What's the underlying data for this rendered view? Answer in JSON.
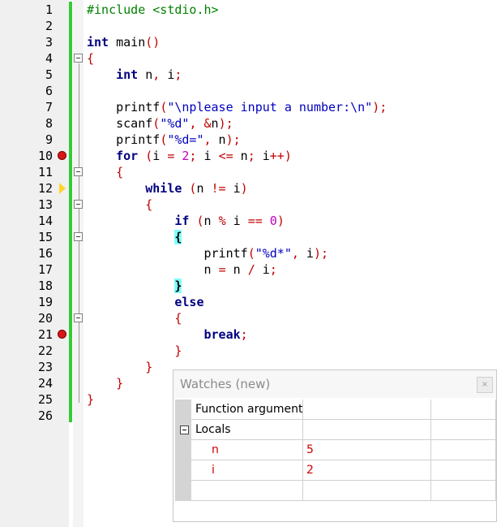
{
  "editor": {
    "line_numbers": [
      "1",
      "2",
      "3",
      "4",
      "5",
      "6",
      "7",
      "8",
      "9",
      "10",
      "11",
      "12",
      "13",
      "14",
      "15",
      "16",
      "17",
      "18",
      "19",
      "20",
      "21",
      "22",
      "23",
      "24",
      "25",
      "26"
    ],
    "lines": [
      [
        {
          "t": "#include <stdio.h>",
          "c": "pp"
        }
      ],
      [],
      [
        {
          "t": "int",
          "c": "kw"
        },
        {
          "t": " main"
        },
        {
          "t": "()",
          "c": "op"
        }
      ],
      [
        {
          "t": "{",
          "c": "op"
        }
      ],
      [
        {
          "t": "    "
        },
        {
          "t": "int",
          "c": "kw"
        },
        {
          "t": " n"
        },
        {
          "t": ",",
          "c": "op"
        },
        {
          "t": " i"
        },
        {
          "t": ";",
          "c": "op"
        }
      ],
      [],
      [
        {
          "t": "    printf"
        },
        {
          "t": "(",
          "c": "op"
        },
        {
          "t": "\"\\nplease input a number:\\n\"",
          "c": "str"
        },
        {
          "t": ");",
          "c": "op"
        }
      ],
      [
        {
          "t": "    scanf"
        },
        {
          "t": "(",
          "c": "op"
        },
        {
          "t": "\"%d\"",
          "c": "str"
        },
        {
          "t": ", &",
          "c": "op"
        },
        {
          "t": "n"
        },
        {
          "t": ");",
          "c": "op"
        }
      ],
      [
        {
          "t": "    printf"
        },
        {
          "t": "(",
          "c": "op"
        },
        {
          "t": "\"%d=\"",
          "c": "str"
        },
        {
          "t": ",",
          "c": "op"
        },
        {
          "t": " n"
        },
        {
          "t": ");",
          "c": "op"
        }
      ],
      [
        {
          "t": "    "
        },
        {
          "t": "for",
          "c": "kw"
        },
        {
          "t": " (",
          "c": "op"
        },
        {
          "t": "i "
        },
        {
          "t": "=",
          "c": "op"
        },
        {
          "t": " "
        },
        {
          "t": "2",
          "c": "num"
        },
        {
          "t": ";",
          "c": "op"
        },
        {
          "t": " i "
        },
        {
          "t": "<=",
          "c": "op"
        },
        {
          "t": " n"
        },
        {
          "t": ";",
          "c": "op"
        },
        {
          "t": " i"
        },
        {
          "t": "++)",
          "c": "op"
        }
      ],
      [
        {
          "t": "    "
        },
        {
          "t": "{",
          "c": "op"
        }
      ],
      [
        {
          "t": "        "
        },
        {
          "t": "while",
          "c": "kw"
        },
        {
          "t": " (",
          "c": "op"
        },
        {
          "t": "n "
        },
        {
          "t": "!=",
          "c": "op"
        },
        {
          "t": " i"
        },
        {
          "t": ")",
          "c": "op"
        }
      ],
      [
        {
          "t": "        "
        },
        {
          "t": "{",
          "c": "op"
        }
      ],
      [
        {
          "t": "            "
        },
        {
          "t": "if",
          "c": "kw"
        },
        {
          "t": " (",
          "c": "op"
        },
        {
          "t": "n "
        },
        {
          "t": "%",
          "c": "op"
        },
        {
          "t": " i "
        },
        {
          "t": "==",
          "c": "op"
        },
        {
          "t": " "
        },
        {
          "t": "0",
          "c": "num"
        },
        {
          "t": ")",
          "c": "op"
        }
      ],
      [
        {
          "t": "            "
        },
        {
          "t": "{",
          "c": "hl"
        }
      ],
      [
        {
          "t": "                printf"
        },
        {
          "t": "(",
          "c": "op"
        },
        {
          "t": "\"%d*\"",
          "c": "str"
        },
        {
          "t": ",",
          "c": "op"
        },
        {
          "t": " i"
        },
        {
          "t": ");",
          "c": "op"
        }
      ],
      [
        {
          "t": "                n "
        },
        {
          "t": "=",
          "c": "op"
        },
        {
          "t": " n "
        },
        {
          "t": "/",
          "c": "op"
        },
        {
          "t": " i"
        },
        {
          "t": ";",
          "c": "op"
        }
      ],
      [
        {
          "t": "            "
        },
        {
          "t": "}",
          "c": "hl"
        }
      ],
      [
        {
          "t": "            "
        },
        {
          "t": "else",
          "c": "kw"
        }
      ],
      [
        {
          "t": "            "
        },
        {
          "t": "{",
          "c": "op"
        }
      ],
      [
        {
          "t": "                "
        },
        {
          "t": "break",
          "c": "kw"
        },
        {
          "t": ";",
          "c": "op"
        }
      ],
      [
        {
          "t": "            "
        },
        {
          "t": "}",
          "c": "op"
        }
      ],
      [
        {
          "t": "        "
        },
        {
          "t": "}",
          "c": "op"
        }
      ],
      [
        {
          "t": "    "
        },
        {
          "t": "}",
          "c": "op"
        }
      ],
      [
        {
          "t": "}",
          "c": "op"
        }
      ],
      []
    ],
    "breakpoint_lines": [
      10,
      21
    ],
    "current_line": 12,
    "fold_lines": [
      4,
      11,
      13,
      15,
      20
    ]
  },
  "watches": {
    "title": "Watches (new)",
    "close_label": "×",
    "rows": [
      {
        "name": "Function arguments",
        "value": "",
        "type": "",
        "kind": "group"
      },
      {
        "name": "Locals",
        "value": "",
        "type": "",
        "kind": "group-expanded"
      },
      {
        "name": "n",
        "value": "5",
        "type": "",
        "kind": "var"
      },
      {
        "name": "i",
        "value": "2",
        "type": "",
        "kind": "var"
      },
      {
        "name": "",
        "value": "",
        "type": "",
        "kind": "empty"
      }
    ]
  },
  "colors": {
    "keyword": "#000080",
    "operator": "#c00000",
    "string": "#0000c0",
    "number": "#c000c0",
    "preprocessor": "#008000",
    "brace_match": "#80ffff",
    "change_bar": "#33cc33",
    "breakpoint": "#d81818",
    "current_line_marker": "#ffd52b"
  }
}
